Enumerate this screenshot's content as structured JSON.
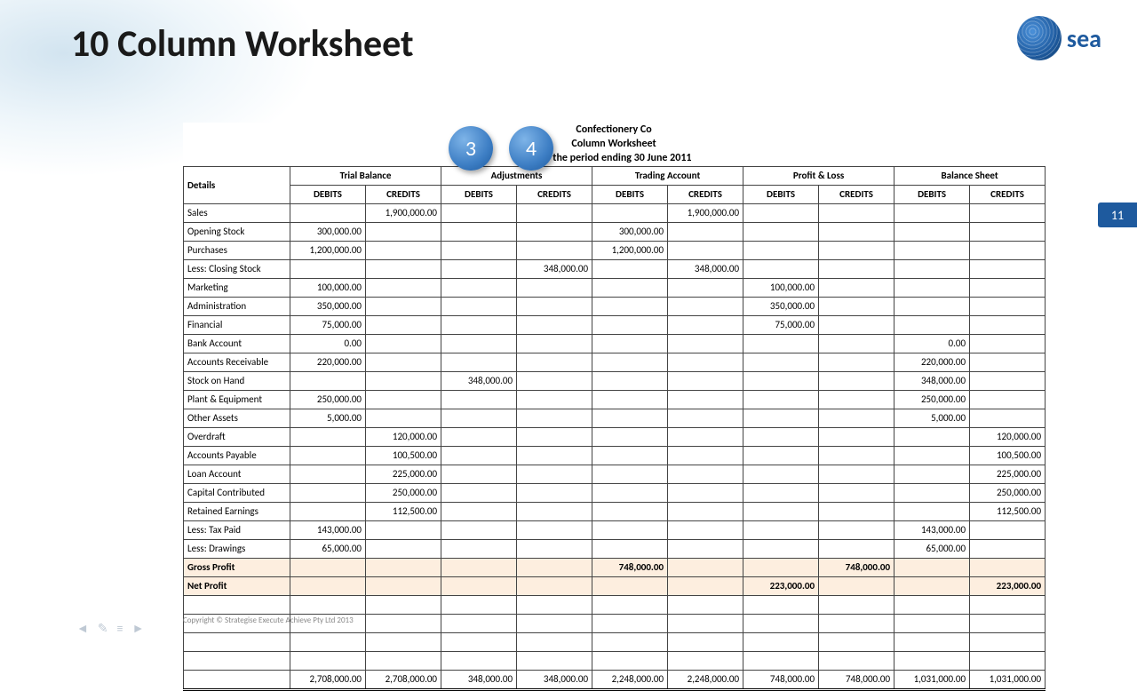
{
  "slide": {
    "title": "10 Column Worksheet",
    "page_number": "11",
    "copyright": "Copyright © Strategise Execute Achieve Pty Ltd 2013",
    "logo_text": "sea"
  },
  "callouts": [
    "3",
    "4"
  ],
  "worksheet": {
    "company": "Confectionery Co",
    "doc_title": "Column Worksheet",
    "period": "For the period ending 30 June 2011",
    "col_header_detail": "Details",
    "groups": [
      "Trial Balance",
      "Adjustments",
      "Trading Account",
      "Profit & Loss",
      "Balance Sheet"
    ],
    "subheads": {
      "dr": "DEBITS",
      "cr": "CREDITS"
    },
    "rows": [
      {
        "label": "Sales",
        "tb_dr": "",
        "tb_cr": "1,900,000.00",
        "adj_dr": "",
        "adj_cr": "",
        "ta_dr": "",
        "ta_cr": "1,900,000.00",
        "pl_dr": "",
        "pl_cr": "",
        "bs_dr": "",
        "bs_cr": ""
      },
      {
        "label": "Opening Stock",
        "tb_dr": "300,000.00",
        "tb_cr": "",
        "adj_dr": "",
        "adj_cr": "",
        "ta_dr": "300,000.00",
        "ta_cr": "",
        "pl_dr": "",
        "pl_cr": "",
        "bs_dr": "",
        "bs_cr": ""
      },
      {
        "label": "Purchases",
        "tb_dr": "1,200,000.00",
        "tb_cr": "",
        "adj_dr": "",
        "adj_cr": "",
        "ta_dr": "1,200,000.00",
        "ta_cr": "",
        "pl_dr": "",
        "pl_cr": "",
        "bs_dr": "",
        "bs_cr": ""
      },
      {
        "label": "Less: Closing Stock",
        "tb_dr": "",
        "tb_cr": "",
        "adj_dr": "",
        "adj_cr": "348,000.00",
        "ta_dr": "",
        "ta_cr": "348,000.00",
        "pl_dr": "",
        "pl_cr": "",
        "bs_dr": "",
        "bs_cr": ""
      },
      {
        "label": "Marketing",
        "tb_dr": "100,000.00",
        "tb_cr": "",
        "adj_dr": "",
        "adj_cr": "",
        "ta_dr": "",
        "ta_cr": "",
        "pl_dr": "100,000.00",
        "pl_cr": "",
        "bs_dr": "",
        "bs_cr": ""
      },
      {
        "label": "Administration",
        "tb_dr": "350,000.00",
        "tb_cr": "",
        "adj_dr": "",
        "adj_cr": "",
        "ta_dr": "",
        "ta_cr": "",
        "pl_dr": "350,000.00",
        "pl_cr": "",
        "bs_dr": "",
        "bs_cr": ""
      },
      {
        "label": "Financial",
        "tb_dr": "75,000.00",
        "tb_cr": "",
        "adj_dr": "",
        "adj_cr": "",
        "ta_dr": "",
        "ta_cr": "",
        "pl_dr": "75,000.00",
        "pl_cr": "",
        "bs_dr": "",
        "bs_cr": ""
      },
      {
        "label": "Bank Account",
        "tb_dr": "0.00",
        "tb_cr": "",
        "adj_dr": "",
        "adj_cr": "",
        "ta_dr": "",
        "ta_cr": "",
        "pl_dr": "",
        "pl_cr": "",
        "bs_dr": "0.00",
        "bs_cr": ""
      },
      {
        "label": "Accounts Receivable",
        "tb_dr": "220,000.00",
        "tb_cr": "",
        "adj_dr": "",
        "adj_cr": "",
        "ta_dr": "",
        "ta_cr": "",
        "pl_dr": "",
        "pl_cr": "",
        "bs_dr": "220,000.00",
        "bs_cr": ""
      },
      {
        "label": "Stock on Hand",
        "tb_dr": "",
        "tb_cr": "",
        "adj_dr": "348,000.00",
        "adj_cr": "",
        "ta_dr": "",
        "ta_cr": "",
        "pl_dr": "",
        "pl_cr": "",
        "bs_dr": "348,000.00",
        "bs_cr": ""
      },
      {
        "label": "Plant & Equipment",
        "tb_dr": "250,000.00",
        "tb_cr": "",
        "adj_dr": "",
        "adj_cr": "",
        "ta_dr": "",
        "ta_cr": "",
        "pl_dr": "",
        "pl_cr": "",
        "bs_dr": "250,000.00",
        "bs_cr": ""
      },
      {
        "label": "Other Assets",
        "tb_dr": "5,000.00",
        "tb_cr": "",
        "adj_dr": "",
        "adj_cr": "",
        "ta_dr": "",
        "ta_cr": "",
        "pl_dr": "",
        "pl_cr": "",
        "bs_dr": "5,000.00",
        "bs_cr": ""
      },
      {
        "label": "Overdraft",
        "tb_dr": "",
        "tb_cr": "120,000.00",
        "adj_dr": "",
        "adj_cr": "",
        "ta_dr": "",
        "ta_cr": "",
        "pl_dr": "",
        "pl_cr": "",
        "bs_dr": "",
        "bs_cr": "120,000.00"
      },
      {
        "label": "Accounts Payable",
        "tb_dr": "",
        "tb_cr": "100,500.00",
        "adj_dr": "",
        "adj_cr": "",
        "ta_dr": "",
        "ta_cr": "",
        "pl_dr": "",
        "pl_cr": "",
        "bs_dr": "",
        "bs_cr": "100,500.00"
      },
      {
        "label": "Loan Account",
        "tb_dr": "",
        "tb_cr": "225,000.00",
        "adj_dr": "",
        "adj_cr": "",
        "ta_dr": "",
        "ta_cr": "",
        "pl_dr": "",
        "pl_cr": "",
        "bs_dr": "",
        "bs_cr": "225,000.00"
      },
      {
        "label": "Capital Contributed",
        "tb_dr": "",
        "tb_cr": "250,000.00",
        "adj_dr": "",
        "adj_cr": "",
        "ta_dr": "",
        "ta_cr": "",
        "pl_dr": "",
        "pl_cr": "",
        "bs_dr": "",
        "bs_cr": "250,000.00"
      },
      {
        "label": "Retained Earnings",
        "tb_dr": "",
        "tb_cr": "112,500.00",
        "adj_dr": "",
        "adj_cr": "",
        "ta_dr": "",
        "ta_cr": "",
        "pl_dr": "",
        "pl_cr": "",
        "bs_dr": "",
        "bs_cr": "112,500.00"
      },
      {
        "label": "Less: Tax Paid",
        "tb_dr": "143,000.00",
        "tb_cr": "",
        "adj_dr": "",
        "adj_cr": "",
        "ta_dr": "",
        "ta_cr": "",
        "pl_dr": "",
        "pl_cr": "",
        "bs_dr": "143,000.00",
        "bs_cr": ""
      },
      {
        "label": "Less: Drawings",
        "tb_dr": "65,000.00",
        "tb_cr": "",
        "adj_dr": "",
        "adj_cr": "",
        "ta_dr": "",
        "ta_cr": "",
        "pl_dr": "",
        "pl_cr": "",
        "bs_dr": "65,000.00",
        "bs_cr": ""
      }
    ],
    "gross_profit": {
      "label": "Gross Profit",
      "ta_dr": "748,000.00",
      "pl_cr": "748,000.00"
    },
    "net_profit": {
      "label": "Net Profit",
      "pl_dr": "223,000.00",
      "bs_cr": "223,000.00"
    },
    "totals": {
      "tb_dr": "2,708,000.00",
      "tb_cr": "2,708,000.00",
      "adj_dr": "348,000.00",
      "adj_cr": "348,000.00",
      "ta_dr": "2,248,000.00",
      "ta_cr": "2,248,000.00",
      "pl_dr": "748,000.00",
      "pl_cr": "748,000.00",
      "bs_dr": "1,031,000.00",
      "bs_cr": "1,031,000.00"
    }
  }
}
